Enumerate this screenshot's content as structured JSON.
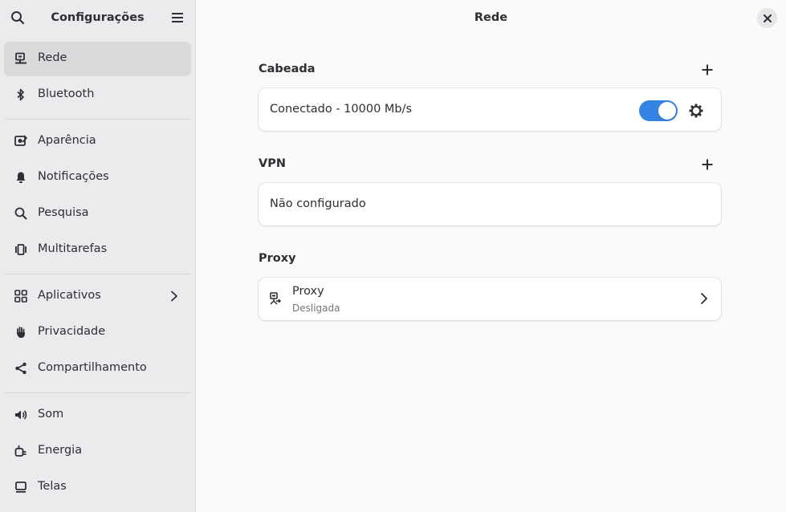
{
  "sidebar": {
    "title": "Configurações",
    "search_icon": "search-icon",
    "menu_icon": "hamburger-menu-icon",
    "items": [
      {
        "label": "Rede",
        "icon": "network-wired-icon",
        "active": true
      },
      {
        "label": "Bluetooth",
        "icon": "bluetooth-icon"
      },
      {
        "label": "Aparência",
        "icon": "appearance-icon"
      },
      {
        "label": "Notificações",
        "icon": "bell-icon"
      },
      {
        "label": "Pesquisa",
        "icon": "search-icon"
      },
      {
        "label": "Multitarefas",
        "icon": "multitasking-icon"
      },
      {
        "label": "Aplicativos",
        "icon": "apps-grid-icon",
        "has_chevron": true
      },
      {
        "label": "Privacidade",
        "icon": "hand-icon"
      },
      {
        "label": "Compartilhamento",
        "icon": "share-icon"
      },
      {
        "label": "Som",
        "icon": "speaker-icon"
      },
      {
        "label": "Energia",
        "icon": "power-plug-icon"
      },
      {
        "label": "Telas",
        "icon": "display-icon"
      }
    ]
  },
  "main": {
    "title": "Rede",
    "wired": {
      "section_title": "Cabeada",
      "status": "Conectado - 10000 Mb/s",
      "toggle_on": true
    },
    "vpn": {
      "section_title": "VPN",
      "status": "Não configurado"
    },
    "proxy": {
      "section_title": "Proxy",
      "title": "Proxy",
      "subtitle": "Desligada"
    }
  },
  "colors": {
    "accent": "#3584e4",
    "sidebar_bg": "#ebebed",
    "main_bg": "#fafafb",
    "active_item_bg": "#dadadc"
  }
}
